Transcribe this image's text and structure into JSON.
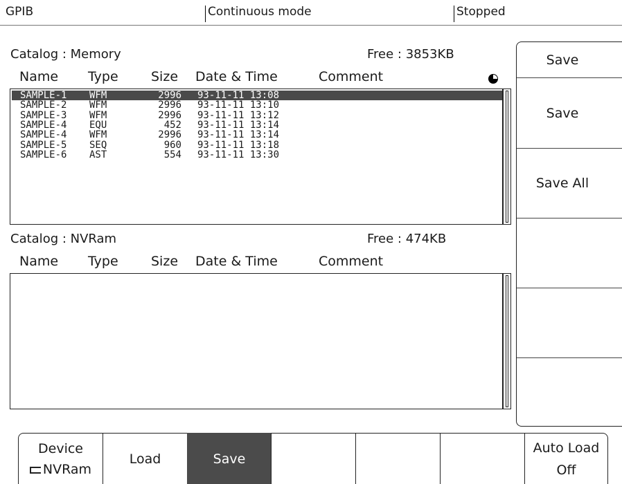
{
  "status_bar": {
    "interface": "GPIB",
    "mode": "Continuous mode",
    "state": "Stopped"
  },
  "memory_catalog": {
    "title": "Catalog : Memory",
    "free": "Free : 3853KB",
    "columns": [
      "Name",
      "Type",
      "Size",
      "Date & Time",
      "Comment"
    ],
    "rows": [
      {
        "name": "SAMPLE-1",
        "type": "WFM",
        "size": "2996",
        "datetime": "93-11-11 13:08"
      },
      {
        "name": "SAMPLE-2",
        "type": "WFM",
        "size": "2996",
        "datetime": "93-11-11 13:10"
      },
      {
        "name": "SAMPLE-3",
        "type": "WFM",
        "size": "2996",
        "datetime": "93-11-11 13:12"
      },
      {
        "name": "SAMPLE-4",
        "type": "EQU",
        "size": "452",
        "datetime": "93-11-11 13:14"
      },
      {
        "name": "SAMPLE-4",
        "type": "WFM",
        "size": "2996",
        "datetime": "93-11-11 13:14"
      },
      {
        "name": "SAMPLE-5",
        "type": "SEQ",
        "size": "960",
        "datetime": "93-11-11 13:18"
      },
      {
        "name": "SAMPLE-6",
        "type": "AST",
        "size": "554",
        "datetime": "93-11-11 13:30"
      }
    ],
    "selected_index": 0
  },
  "nvram_catalog": {
    "title": "Catalog : NVRam",
    "free": "Free : 474KB",
    "columns": [
      "Name",
      "Type",
      "Size",
      "Date & Time",
      "Comment"
    ],
    "rows": []
  },
  "side_menu": {
    "items": [
      "Save",
      "Save",
      "Save All",
      "",
      "",
      ""
    ]
  },
  "bottom_menu": {
    "device_label": "Device",
    "device_value": "NVRam",
    "load_label": "Load",
    "save_label": "Save",
    "auto_load_label": "Auto Load",
    "auto_load_value": "Off",
    "active": "Save"
  },
  "colors": {
    "selection": "#4a4a4a",
    "active_key": "#4b4b4b"
  }
}
